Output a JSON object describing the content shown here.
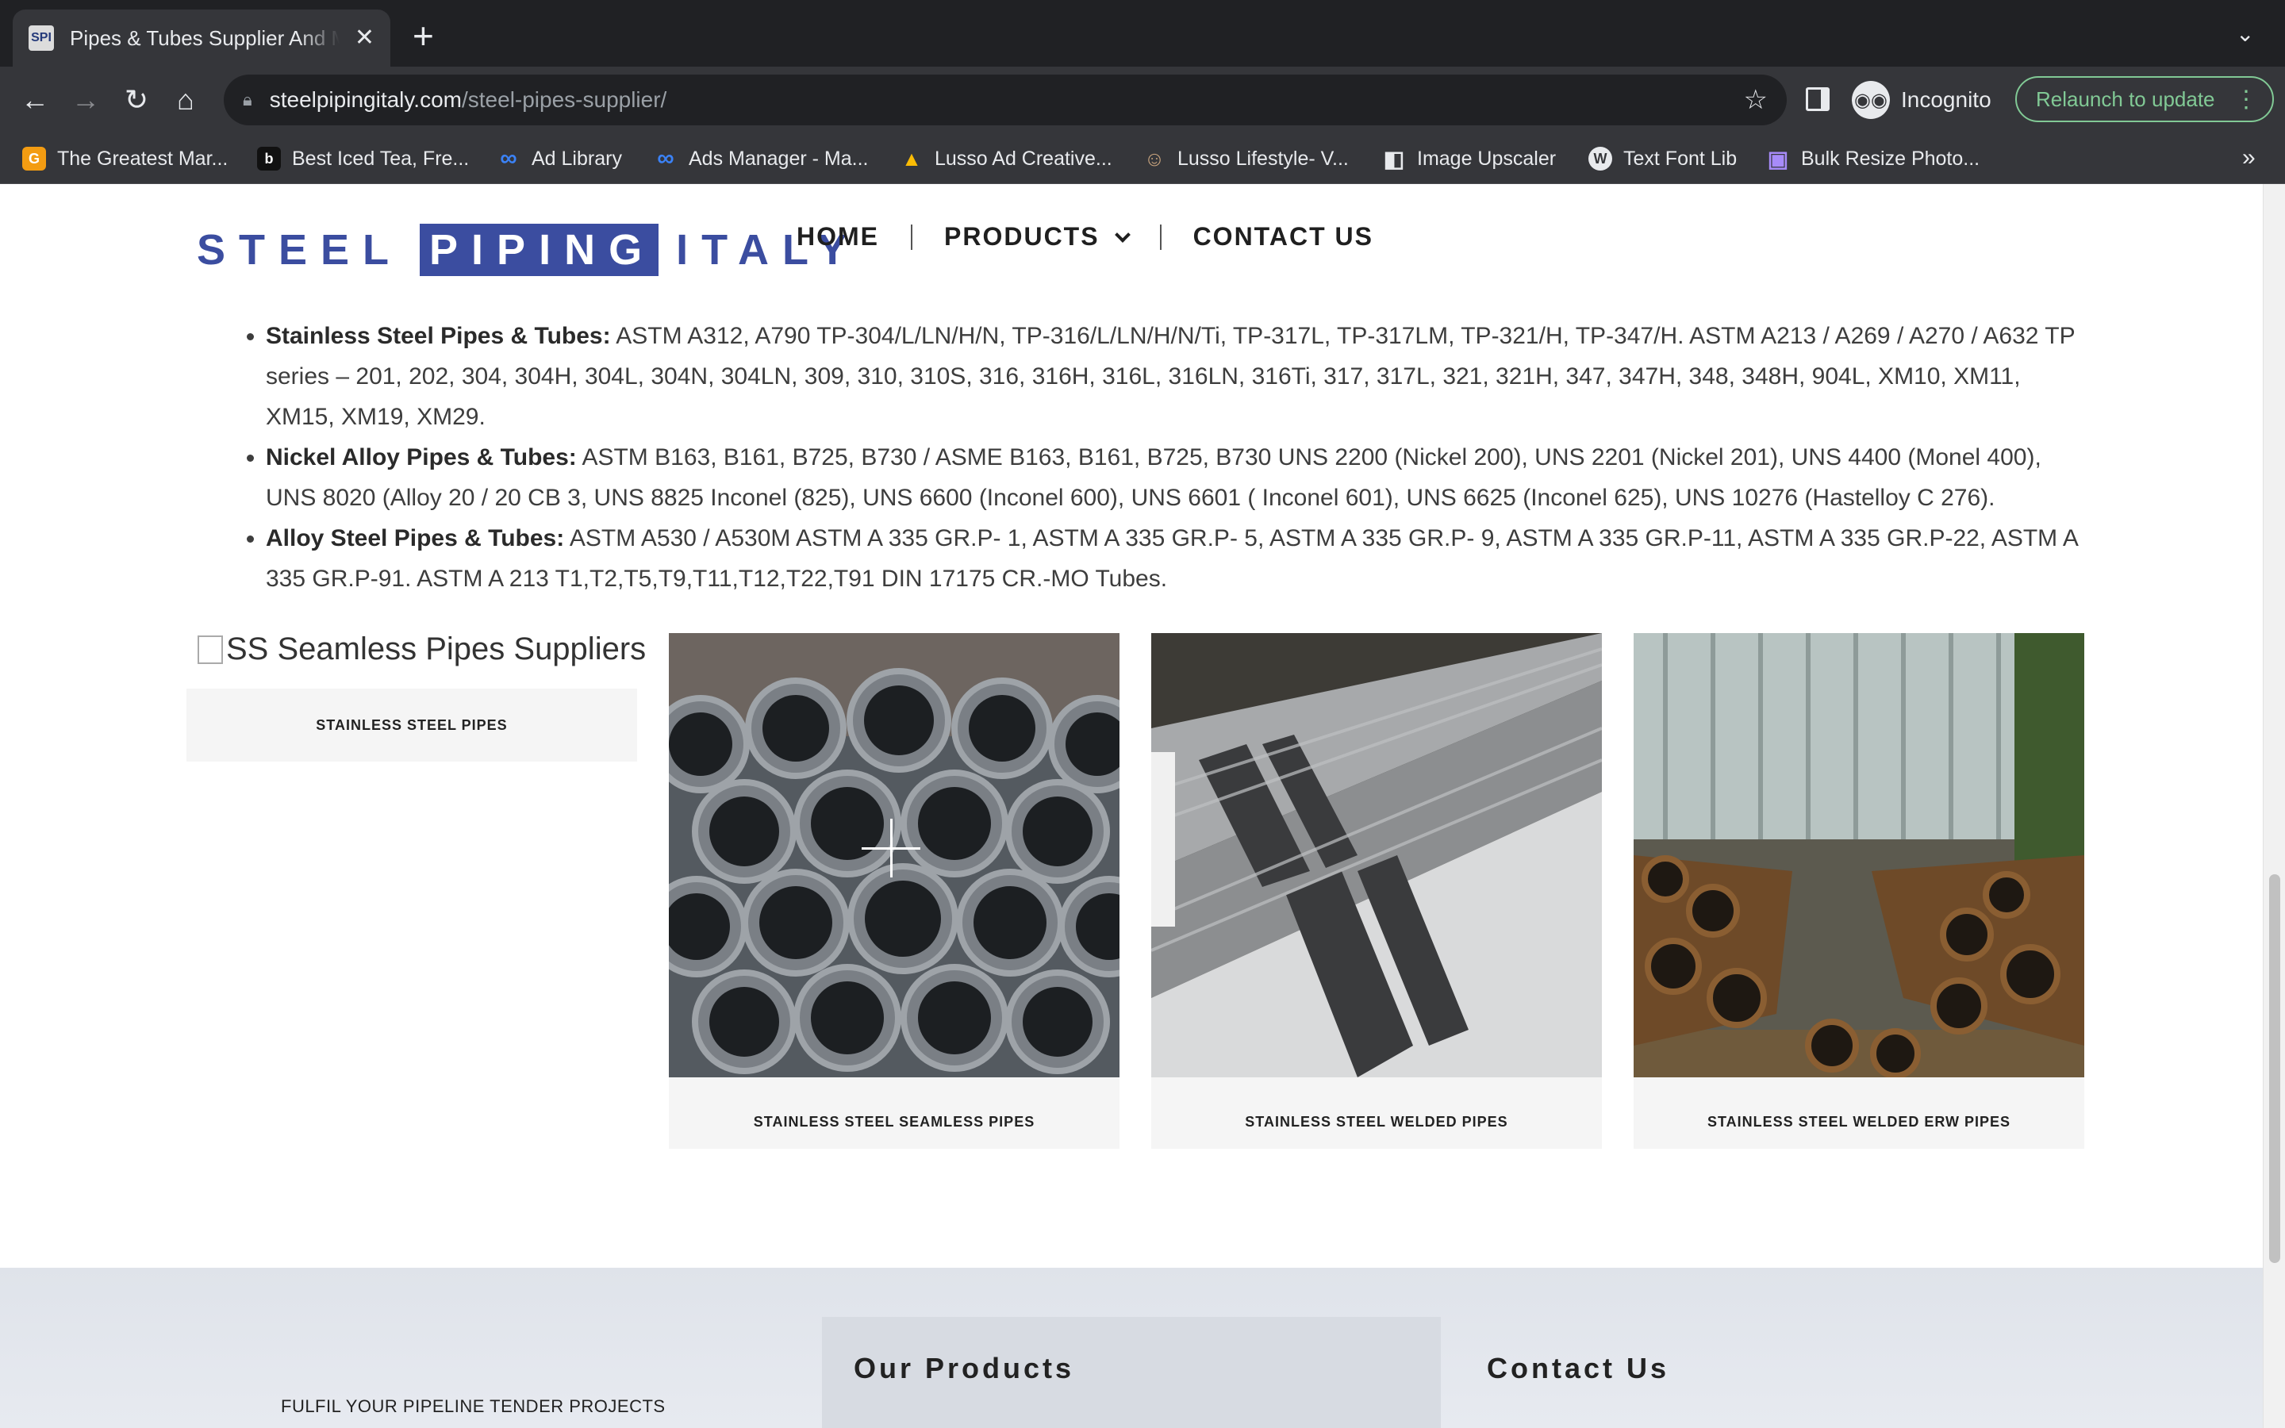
{
  "browser": {
    "tab_title": "Pipes & Tubes Supplier And Manufacturer",
    "tab_favicon_text": "SPI",
    "url_domain": "steelpipingitaly.com",
    "url_path": "/steel-pipes-supplier/",
    "incognito_label": "Incognito",
    "relaunch_label": "Relaunch to update",
    "bookmarks": [
      {
        "label": "The Greatest Mar...",
        "icon": "G",
        "color": "#f39c12"
      },
      {
        "label": "Best Iced Tea, Fre...",
        "icon": "b",
        "color": "#111111"
      },
      {
        "label": "Ad Library",
        "icon": "∞",
        "color": "#1877f2"
      },
      {
        "label": "Ads Manager - Ma...",
        "icon": "∞",
        "color": "#1877f2"
      },
      {
        "label": "Lusso Ad Creative...",
        "icon": "▲",
        "color": "#34a853"
      },
      {
        "label": "Lusso Lifestyle- V...",
        "icon": "☺",
        "color": "#6b4e2e"
      },
      {
        "label": "Image Upscaler",
        "icon": "◧",
        "color": "#111111"
      },
      {
        "label": "Text Font Lib",
        "icon": "W",
        "color": "#3c6e9c"
      },
      {
        "label": "Bulk Resize Photo...",
        "icon": "▣",
        "color": "#7b5cd6"
      }
    ]
  },
  "site": {
    "logo": {
      "left": "STEEL",
      "highlight": "PIPING",
      "right": "ITALY"
    },
    "nav": {
      "home": "HOME",
      "products": "PRODUCTS",
      "contact": "CONTACT US"
    }
  },
  "specs": [
    {
      "title": "Stainless Steel Pipes & Tubes:",
      "text": " ASTM A312, A790 TP-304/L/LN/H/N, TP-316/L/LN/H/N/Ti, TP-317L, TP-317LM, TP-321/H, TP-347/H. ASTM A213 / A269 / A270 / A632 TP series – 201, 202, 304, 304H, 304L, 304N, 304LN, 309, 310, 310S, 316, 316H, 316L, 316LN, 316Ti, 317, 317L, 321, 321H, 347, 347H, 348, 348H, 904L, XM10, XM11, XM15, XM19, XM29."
    },
    {
      "title": "Nickel Alloy Pipes & Tubes:",
      "text": " ASTM B163, B161, B725, B730 / ASME B163, B161, B725, B730 UNS 2200 (Nickel 200), UNS 2201 (Nickel 201), UNS 4400 (Monel 400), UNS 8020 (Alloy 20 / 20 CB 3, UNS 8825 Inconel (825), UNS 6600 (Inconel 600), UNS 6601 ( Inconel 601), UNS 6625 (Inconel 625), UNS 10276 (Hastelloy C 276)."
    },
    {
      "title": "Alloy Steel Pipes & Tubes:",
      "text": " ASTM A530 / A530M ASTM A 335 GR.P- 1, ASTM A 335 GR.P- 5, ASTM A 335 GR.P- 9, ASTM A 335 GR.P-11, ASTM A 335 GR.P-22, ASTM A 335 GR.P-91. ASTM A 213 T1,T2,T5,T9,T11,T12,T22,T91 DIN 17175 CR.-MO Tubes."
    }
  ],
  "products": {
    "broken_alt": "SS Seamless Pipes Suppliers",
    "cards": [
      {
        "caption": "STAINLESS STEEL PIPES"
      },
      {
        "caption": "STAINLESS STEEL SEAMLESS PIPES"
      },
      {
        "caption": "STAINLESS STEEL WELDED PIPES"
      },
      {
        "caption": "STAINLESS STEEL WELDED ERW PIPES"
      }
    ]
  },
  "footer": {
    "tagline": "FULFIL YOUR PIPELINE TENDER PROJECTS",
    "products_heading": "Our Products",
    "contact_heading": "Contact Us"
  }
}
